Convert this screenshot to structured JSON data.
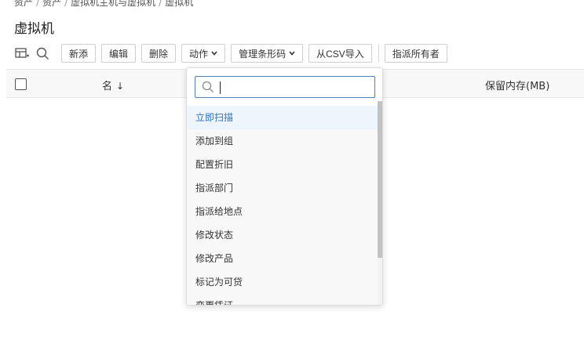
{
  "breadcrumb": {
    "items": [
      "资产",
      "资产",
      "虚拟机主机与虚拟机",
      "虚拟机"
    ],
    "separator": "/"
  },
  "page": {
    "title": "虚拟机"
  },
  "toolbar": {
    "icons": [
      "table-columns-icon",
      "search-icon"
    ],
    "new_label": "新添",
    "edit_label": "编辑",
    "delete_label": "删除",
    "actions_label": "动作",
    "barcode_label": "管理条形码",
    "import_csv_label": "从CSV导入",
    "assign_owner_label": "指派所有者"
  },
  "table": {
    "columns": {
      "name": "名",
      "sort_indicator": "↓",
      "reserved_memory": "保留内存(MB)"
    }
  },
  "actions_menu": {
    "search_value": "",
    "items": [
      {
        "label": "立即扫描",
        "highlighted": true
      },
      {
        "label": "添加到组",
        "highlighted": false
      },
      {
        "label": "配置折旧",
        "highlighted": false
      },
      {
        "label": "指派部门",
        "highlighted": false
      },
      {
        "label": "指派给地点",
        "highlighted": false
      },
      {
        "label": "修改状态",
        "highlighted": false
      },
      {
        "label": "修改产品",
        "highlighted": false
      },
      {
        "label": "标记为可贷",
        "highlighted": false
      },
      {
        "label": "变更凭证",
        "highlighted": false
      }
    ]
  },
  "colors": {
    "accent": "#2f74c0",
    "highlight_bg": "#eef5fc",
    "input_border": "#4a7fc1"
  }
}
